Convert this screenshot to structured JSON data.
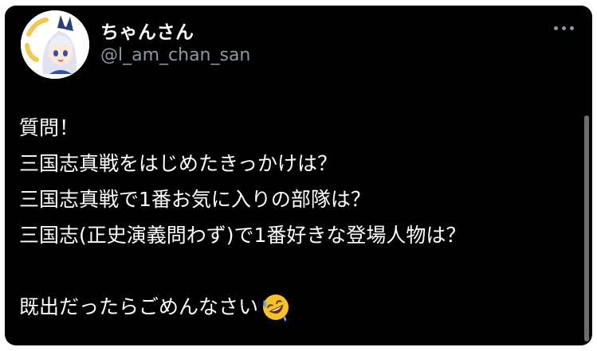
{
  "tweet": {
    "author": {
      "display_name": "ちゃんさん",
      "handle": "@l_am_chan_san",
      "avatar_icon": "anime-girl-avatar-icon"
    },
    "more_icon": "more-horizontal-icon",
    "lines": [
      "質問！",
      "三国志真戦をはじめたきっかけは？",
      "三国志真戦で1番お気に入りの部隊は？",
      "三国志(正史演義問わず)で1番好きな登場人物は？",
      "",
      "既出だったらごめんなさい"
    ],
    "trailing_emoji": "rolling-on-floor-laughing-emoji"
  },
  "colors": {
    "background": "#000000",
    "primary_text": "#ffffff",
    "secondary_text": "#8b98a5",
    "scrollbar": "#6e6e6e"
  }
}
